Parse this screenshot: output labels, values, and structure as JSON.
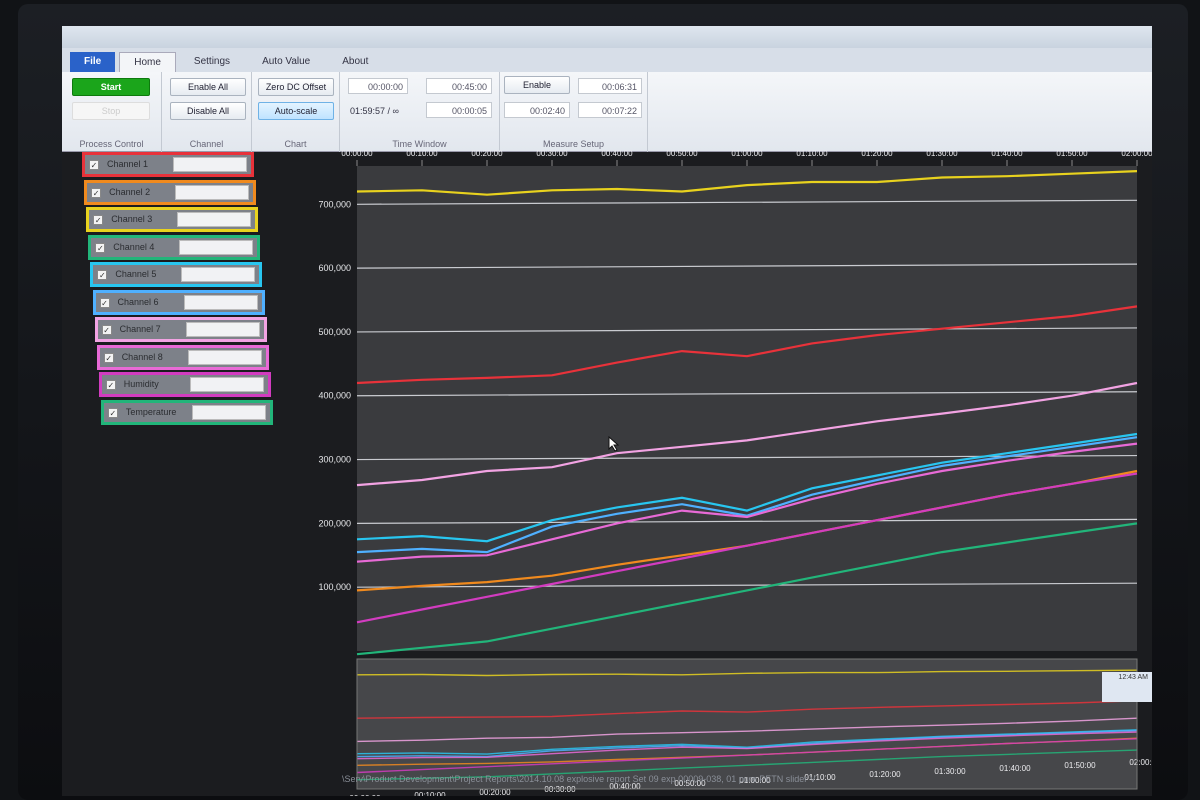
{
  "ribbon": {
    "tabs": [
      "File",
      "Home",
      "Settings",
      "Auto Value",
      "About"
    ],
    "process_control": {
      "start": "Start",
      "stop": "Stop",
      "label": "Process Control"
    },
    "channel": {
      "enable_all": "Enable All",
      "disable_all": "Disable All",
      "label": "Channel"
    },
    "chart": {
      "zero_dc_offset": "Zero DC Offset",
      "auto_scale": "Auto-scale",
      "label": "Chart"
    },
    "time_window": {
      "start": "00:00:00",
      "end": "00:45:00",
      "duration": "01:59:57 / ∞",
      "span": "00:00:05",
      "label": "Time Window"
    },
    "measure_setup": {
      "enable": "Enable",
      "t1": "00:06:31",
      "t2": "00:02:40",
      "t3": "00:07:22",
      "label": "Measure Setup"
    }
  },
  "channels": [
    {
      "name": "Channel 1",
      "color": "#e8323a"
    },
    {
      "name": "Channel 2",
      "color": "#f08a1e"
    },
    {
      "name": "Channel 3",
      "color": "#e8d21e"
    },
    {
      "name": "Channel 4",
      "color": "#22b57a"
    },
    {
      "name": "Channel 5",
      "color": "#28c6f0"
    },
    {
      "name": "Channel 6",
      "color": "#4fb0ff"
    },
    {
      "name": "Channel 7",
      "color": "#f2a3e3"
    },
    {
      "name": "Channel 8",
      "color": "#e86ad6"
    },
    {
      "name": "Humidity",
      "color": "#d23cc0"
    },
    {
      "name": "Temperature",
      "color": "#22b57a"
    }
  ],
  "status_path": "\\Serv\\Product Development\\Project Reports\\2014.10.08 explosive report Set 09 exp 00009-038, 01 pure PETN slider V",
  "tray_time": "12:43 AM",
  "chart_data": {
    "type": "line",
    "x": [
      "00:00:00",
      "00:10:00",
      "00:20:00",
      "00:30:00",
      "00:40:00",
      "00:50:00",
      "01:00:00",
      "01:10:00",
      "01:20:00",
      "01:30:00",
      "01:40:00",
      "01:50:00",
      "02:00:00"
    ],
    "x_ticks": [
      "00:00:00",
      "00:10:00",
      "00:20:00",
      "00:30:00",
      "00:40:00",
      "00:50:00",
      "01:00:00",
      "01:10:00",
      "01:20:00",
      "01:30:00",
      "01:40:00",
      "01:50:00",
      "02:00:00"
    ],
    "y_ticks": [
      "100,000",
      "200,000",
      "300,000",
      "400,000",
      "500,000",
      "600,000",
      "700,000"
    ],
    "ylim": [
      0,
      760000
    ],
    "grid": true,
    "series": [
      {
        "name": "Channel 3",
        "color": "#e8d21e",
        "values": [
          720000,
          722000,
          715000,
          722000,
          724000,
          720000,
          730000,
          735000,
          735000,
          742000,
          744000,
          748000,
          752000
        ]
      },
      {
        "name": "Channel 1",
        "color": "#e8323a",
        "values": [
          420000,
          425000,
          428000,
          432000,
          452000,
          470000,
          462000,
          482000,
          495000,
          505000,
          515000,
          525000,
          540000
        ]
      },
      {
        "name": "Channel 7",
        "color": "#f2a3e3",
        "values": [
          260000,
          268000,
          282000,
          288000,
          310000,
          320000,
          330000,
          345000,
          360000,
          372000,
          385000,
          400000,
          420000
        ]
      },
      {
        "name": "Channel 5",
        "color": "#28c6f0",
        "values": [
          175000,
          180000,
          172000,
          205000,
          225000,
          240000,
          220000,
          255000,
          275000,
          295000,
          310000,
          325000,
          340000
        ]
      },
      {
        "name": "Channel 6",
        "color": "#4fb0ff",
        "values": [
          155000,
          160000,
          155000,
          195000,
          215000,
          230000,
          212000,
          245000,
          268000,
          290000,
          305000,
          320000,
          335000
        ]
      },
      {
        "name": "Channel 8",
        "color": "#e86ad6",
        "values": [
          140000,
          148000,
          150000,
          175000,
          200000,
          220000,
          210000,
          238000,
          262000,
          282000,
          298000,
          312000,
          325000
        ]
      },
      {
        "name": "Channel 2",
        "color": "#f08a1e",
        "values": [
          95000,
          102000,
          108000,
          118000,
          135000,
          150000,
          165000,
          185000,
          205000,
          225000,
          245000,
          262000,
          282000
        ]
      },
      {
        "name": "Humidity",
        "color": "#d23cc0",
        "values": [
          45000,
          65000,
          85000,
          105000,
          125000,
          145000,
          165000,
          185000,
          205000,
          225000,
          245000,
          262000,
          278000
        ]
      },
      {
        "name": "Channel 4",
        "color": "#22b57a",
        "values": [
          -5000,
          5000,
          15000,
          35000,
          55000,
          75000,
          95000,
          115000,
          135000,
          155000,
          170000,
          185000,
          200000
        ]
      }
    ]
  }
}
